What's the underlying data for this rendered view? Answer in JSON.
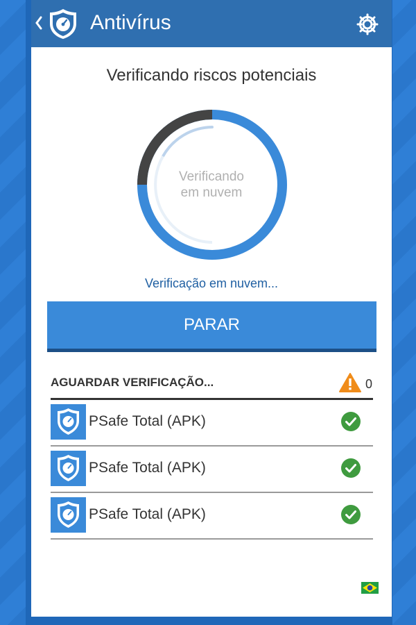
{
  "appbar": {
    "title": "Antivírus",
    "back_icon": "chevron-left-icon",
    "logo_icon": "shield-speedometer-icon",
    "settings_icon": "gear-icon"
  },
  "scan": {
    "heading": "Verificando riscos potenciais",
    "ring_label_line1": "Verificando",
    "ring_label_line2": "em nuvem",
    "status_text": "Verificação em nuvem...",
    "stop_label": "PARAR"
  },
  "queue": {
    "title": "AGUARDAR VERIFICAÇÃO...",
    "warning_count": "0",
    "items": [
      {
        "label": "PSafe Total (APK)",
        "status_icon": "check-circle-icon"
      },
      {
        "label": "PSafe Total (APK)",
        "status_icon": "check-circle-icon"
      },
      {
        "label": "PSafe Total (APK)",
        "status_icon": "check-circle-icon"
      }
    ]
  },
  "footer": {
    "flag_icon": "brazil-flag-icon"
  },
  "colors": {
    "appbar": "#2f6fb0",
    "accent": "#3a8ad9",
    "ring_dark": "#444444",
    "success": "#3f9b3f",
    "warning": "#f08c1a"
  }
}
